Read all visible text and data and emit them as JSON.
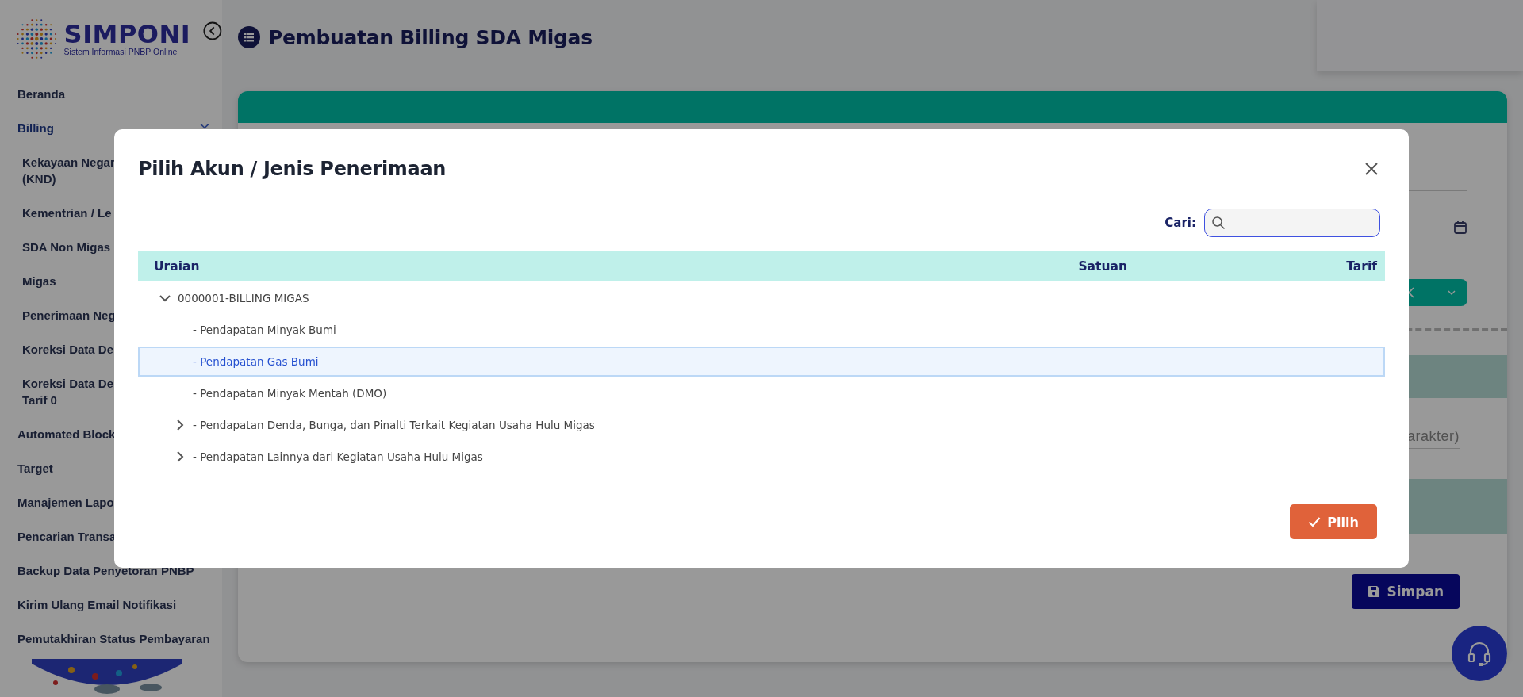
{
  "sidebar": {
    "logo": {
      "title": "SIMPONI",
      "subtitle": "Sistem Informasi PNBP Online"
    },
    "items": [
      {
        "label": "Beranda",
        "selected": false,
        "expanded": false
      },
      {
        "label": "Billing",
        "selected": true,
        "expanded": true,
        "children": [
          {
            "lines": [
              "Kekayaan Negar",
              "(KND)"
            ],
            "selected": false
          },
          {
            "lines": [
              "Kementrian / Le"
            ],
            "selected": false
          },
          {
            "lines": [
              "SDA Non Migas"
            ],
            "selected": false
          },
          {
            "lines": [
              "Migas"
            ],
            "selected": false
          },
          {
            "lines": [
              "Penerimaan Neg"
            ],
            "selected": false
          },
          {
            "lines": [
              "Koreksi Data De"
            ],
            "selected": false
          },
          {
            "lines": [
              "Koreksi Data De",
              "Tarif 0"
            ],
            "selected": false
          }
        ]
      },
      {
        "label": "Automated Block",
        "selected": false,
        "expanded": false
      },
      {
        "label": "Target",
        "selected": false,
        "expanded": false
      },
      {
        "label": "Manajemen Lapo",
        "selected": false,
        "expanded": false
      },
      {
        "label": "Pencarian Transa",
        "selected": false,
        "expanded": false
      },
      {
        "label": "Backup Data Penyetoran PNBP",
        "selected": false,
        "expanded": false
      },
      {
        "label": "Kirim Ulang Email Notifikasi",
        "selected": false,
        "expanded": false
      },
      {
        "label": "Pemutakhiran Status Pembayaran",
        "selected": false,
        "expanded": false
      }
    ]
  },
  "page": {
    "title": "Pembuatan Billing SDA Migas",
    "field_hint": "arakter)",
    "save_button": "Simpan"
  },
  "modal": {
    "title": "Pilih Akun / Jenis Penerimaan",
    "search": {
      "label": "Cari:"
    },
    "columns": [
      "Uraian",
      "Satuan",
      "Tarif"
    ],
    "rows": [
      {
        "label": "0000001-BILLING MIGAS",
        "kind": "group",
        "expanded": true,
        "selected": false,
        "children": [
          {
            "label": "- Pendapatan Minyak Bumi",
            "kind": "leaf",
            "selected": false
          },
          {
            "label": "- Pendapatan Gas Bumi",
            "kind": "leaf",
            "selected": true
          },
          {
            "label": "- Pendapatan Minyak Mentah (DMO)",
            "kind": "leaf",
            "selected": false
          },
          {
            "label": "- Pendapatan Denda, Bunga, dan Pinalti Terkait Kegiatan Usaha Hulu Migas",
            "kind": "group",
            "expanded": false,
            "selected": false
          },
          {
            "label": "- Pendapatan Lainnya dari Kegiatan Usaha Hulu Migas",
            "kind": "group",
            "expanded": false,
            "selected": false
          }
        ]
      }
    ],
    "button": "Pilih"
  }
}
